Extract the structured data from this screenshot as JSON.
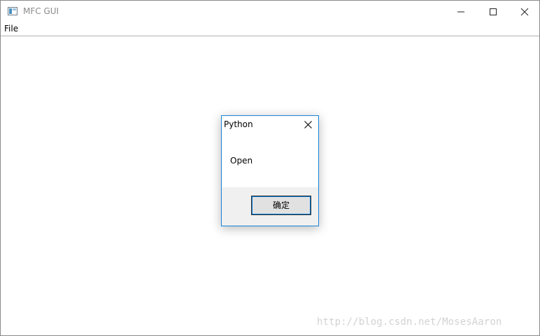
{
  "window": {
    "title": "MFC GUI",
    "icon": "app-window-icon"
  },
  "caption_buttons": [
    "minimize-icon",
    "maximize-icon",
    "close-icon"
  ],
  "menu": {
    "items": [
      {
        "label": "File"
      }
    ]
  },
  "dialog": {
    "title": "Python",
    "message": "Open",
    "ok_label": "确定",
    "accent_color": "#1883d7"
  },
  "watermark": "http://blog.csdn.net/MosesAaron"
}
